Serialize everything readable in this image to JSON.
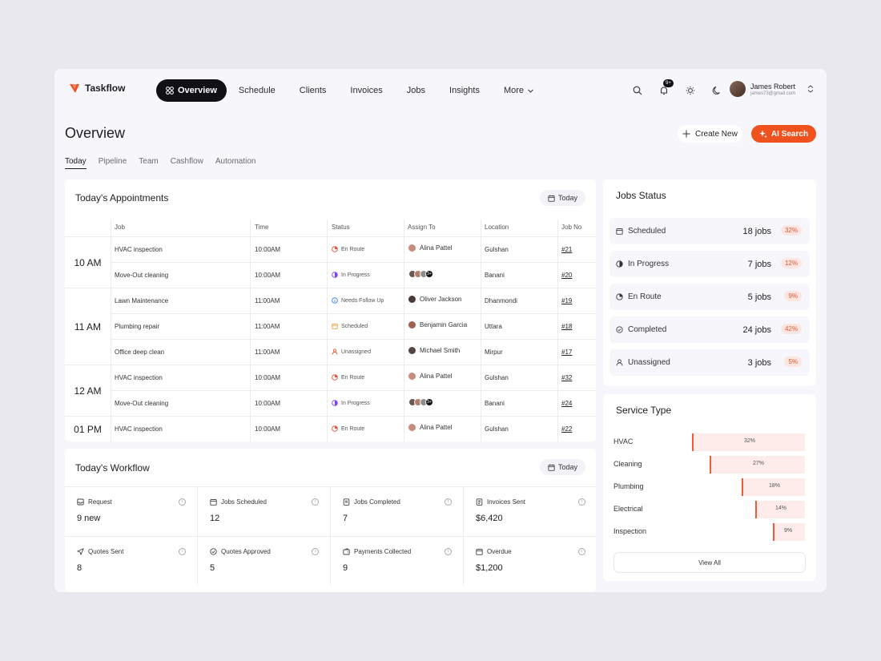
{
  "app": {
    "name": "Taskflow",
    "brand_color": "#f0521f"
  },
  "nav": {
    "active": "Overview",
    "items": [
      "Schedule",
      "Clients",
      "Invoices",
      "Jobs",
      "Insights"
    ],
    "more": "More"
  },
  "topbar": {
    "notification_badge": "9+"
  },
  "user": {
    "name": "James Robert",
    "email": "james73@gmail.com"
  },
  "page": {
    "title": "Overview",
    "create_label": "Create New",
    "ai_search_label": "AI Search",
    "tabs": [
      "Today",
      "Pipeline",
      "Team",
      "Cashflow",
      "Automation"
    ],
    "active_tab": "Today"
  },
  "appointments": {
    "title": "Today's Appointments",
    "filter": "Today",
    "columns": [
      "Job",
      "Time",
      "Status",
      "Assign To",
      "Location",
      "Job No"
    ],
    "slots": [
      "10 AM",
      "11 AM",
      "12 AM",
      "01 PM"
    ],
    "rows": [
      {
        "job": "HVAC inspection",
        "time": "10:00AM",
        "status": "En Route",
        "assignee": "Alina Pattel",
        "location": "Gulshan",
        "job_no": "#21"
      },
      {
        "job": "Move-Out cleaning",
        "time": "10:00AM",
        "status": "In Progress",
        "assignee": "3+",
        "location": "Banani",
        "job_no": "#20"
      },
      {
        "job": "Lawn Maintenance",
        "time": "11:00AM",
        "status": "Needs Follow Up",
        "assignee": "Oliver Jackson",
        "location": "Dhanmondi",
        "job_no": "#19"
      },
      {
        "job": "Plumbing repair",
        "time": "11:00AM",
        "status": "Scheduled",
        "assignee": "Benjamin Garcia",
        "location": "Uttara",
        "job_no": "#18"
      },
      {
        "job": "Office deep clean",
        "time": "11:00AM",
        "status": "Unassigned",
        "assignee": "Michael Smith",
        "location": "Mirpur",
        "job_no": "#17"
      },
      {
        "job": "HVAC inspection",
        "time": "10:00AM",
        "status": "En Route",
        "assignee": "Alina Pattel",
        "location": "Gulshan",
        "job_no": "#32"
      },
      {
        "job": "Move-Out cleaning",
        "time": "10:00AM",
        "status": "In Progress",
        "assignee": "3+",
        "location": "Banani",
        "job_no": "#24"
      },
      {
        "job": "HVAC inspection",
        "time": "10:00AM",
        "status": "En Route",
        "assignee": "Alina Pattel",
        "location": "Gulshan",
        "job_no": "#22"
      }
    ]
  },
  "workflow": {
    "title": "Today's Workflow",
    "filter": "Today",
    "metrics": [
      {
        "label": "Request",
        "value": "9 new",
        "icon": "inbox-icon"
      },
      {
        "label": "Jobs Scheduled",
        "value": "12",
        "icon": "calendar-icon"
      },
      {
        "label": "Jobs Completed",
        "value": "7",
        "icon": "clipboard-check-icon"
      },
      {
        "label": "Invoices Sent",
        "value": "$6,420",
        "icon": "invoice-icon"
      },
      {
        "label": "Quotes Sent",
        "value": "8",
        "icon": "send-icon"
      },
      {
        "label": "Quotes Approved",
        "value": "5",
        "icon": "check-circle-icon"
      },
      {
        "label": "Payments Collected",
        "value": "9",
        "icon": "wallet-icon"
      },
      {
        "label": "Overdue",
        "value": "$1,200",
        "icon": "calendar-alert-icon"
      }
    ]
  },
  "jobs_status": {
    "title": "Jobs Status",
    "items": [
      {
        "label": "Scheduled",
        "count": "18 jobs",
        "pct": "32%"
      },
      {
        "label": "In Progress",
        "count": "7 jobs",
        "pct": "12%"
      },
      {
        "label": "En Route",
        "count": "5 jobs",
        "pct": "9%"
      },
      {
        "label": "Completed",
        "count": "24 jobs",
        "pct": "42%"
      },
      {
        "label": "Unassigned",
        "count": "3 jobs",
        "pct": "5%"
      }
    ]
  },
  "service_type": {
    "title": "Service Type",
    "items": [
      {
        "label": "HVAC",
        "pct_label": "32%",
        "value": 32
      },
      {
        "label": "Cleaning",
        "pct_label": "27%",
        "value": 27
      },
      {
        "label": "Plumbing",
        "pct_label": "18%",
        "value": 18
      },
      {
        "label": "Electrical",
        "pct_label": "14%",
        "value": 14
      },
      {
        "label": "Inspection",
        "pct_label": "9%",
        "value": 9
      }
    ],
    "view_all": "View All"
  }
}
